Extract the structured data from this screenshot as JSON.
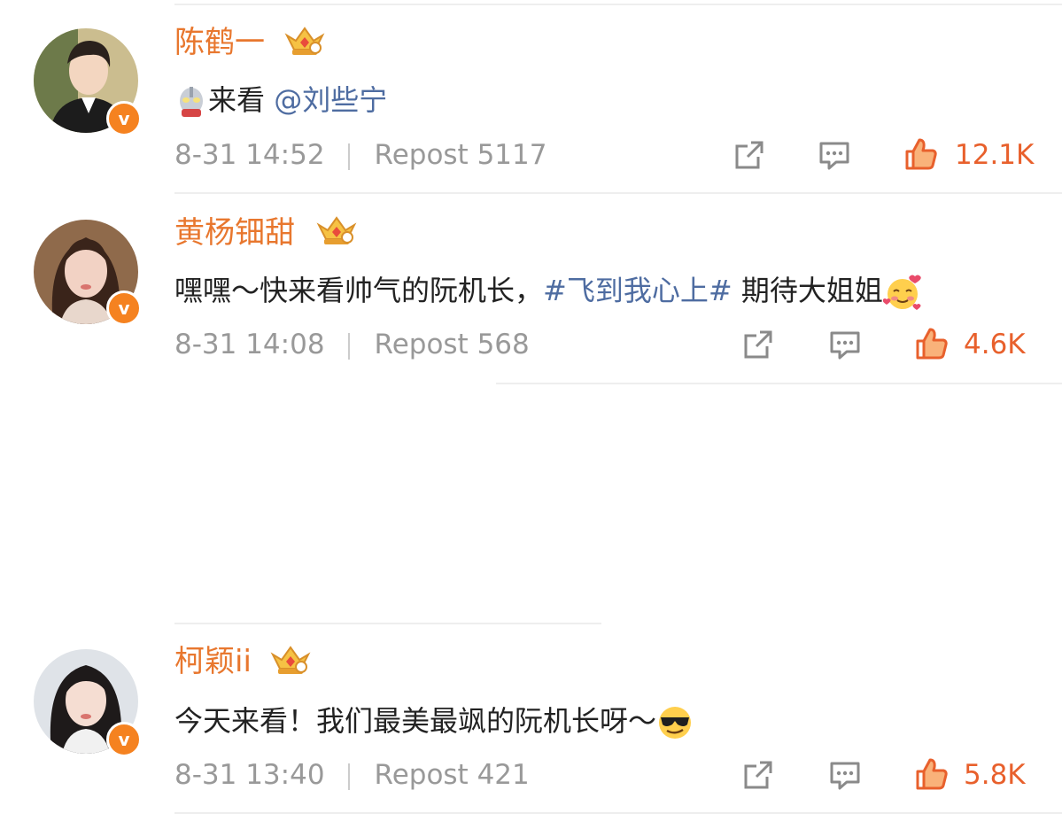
{
  "comments": [
    {
      "username": "陈鹤一",
      "text_before": "来看 ",
      "mention": "@刘些宁",
      "text_after": "",
      "time": "8-31 14:52",
      "repost": "Repost 5117",
      "likes": "12.1K",
      "avatar_colors": {
        "bg": "#c9b98a",
        "hair": "#2a211c",
        "skin": "#f3d6c0",
        "suit": "#1c1c1c"
      }
    },
    {
      "username": "黄杨钿甜",
      "text_before": "嘿嘿～快来看帅气的阮机长，",
      "hashtag": "#飞到我心上#",
      "text_after": " 期待大姐姐",
      "time": "8-31 14:08",
      "repost": "Repost 568",
      "likes": "4.6K",
      "avatar_colors": {
        "bg": "#8f6a4b",
        "hair": "#3a241a",
        "skin": "#f2d2c4",
        "suit": "#e8d7cc"
      }
    },
    {
      "username": "柯颖ii",
      "text_before": "今天来看！我们最美最飒的阮机长呀～",
      "text_after": "",
      "time": "8-31 13:40",
      "repost": "Repost 421",
      "likes": "5.8K",
      "avatar_colors": {
        "bg": "#dfe3e8",
        "hair": "#1e1a1a",
        "skin": "#f5ddd2",
        "suit": "#f1f1f1"
      }
    }
  ],
  "colors": {
    "username": "#e8772e",
    "link": "#4e6ca1",
    "meta": "#999999",
    "like": "#e8602c",
    "verified": "#f58220"
  },
  "icons": [
    "ultraman-emoji",
    "crown-badge-icon",
    "verified-v-icon",
    "share-icon",
    "comment-icon",
    "thumbs-up-icon",
    "blushing-hearts-emoji",
    "sunglasses-emoji"
  ]
}
